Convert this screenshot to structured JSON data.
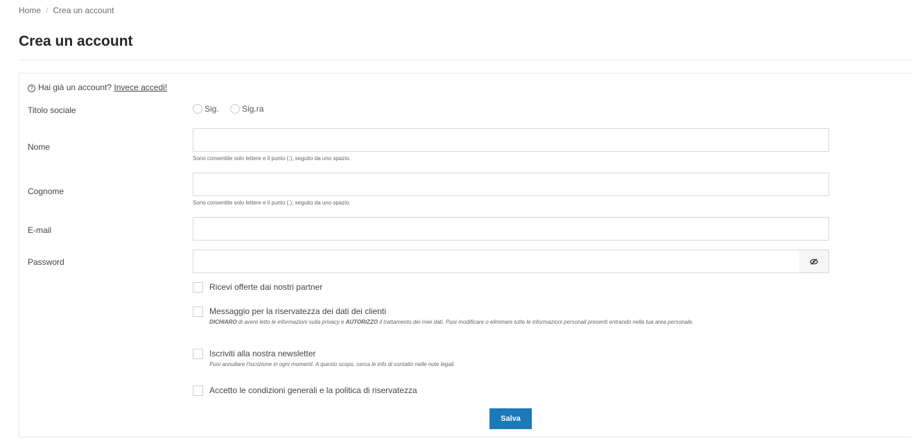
{
  "breadcrumb": {
    "home": "Home",
    "separator": "/",
    "current": "Crea un account"
  },
  "page_title": "Crea un account",
  "login_prompt": {
    "text": "Hai già un account?",
    "link": "Invece accedi!"
  },
  "form": {
    "social_title": {
      "label": "Titolo sociale",
      "options": [
        "Sig.",
        "Sig.ra"
      ]
    },
    "first_name": {
      "label": "Nome",
      "value": "",
      "hint": "Sono consentite solo lettere e il punto (.), seguito da uno spazio."
    },
    "last_name": {
      "label": "Cognome",
      "value": "",
      "hint": "Sono consentite solo lettere e il punto (.), seguito da uno spazio."
    },
    "email": {
      "label": "E-mail",
      "value": ""
    },
    "password": {
      "label": "Password",
      "value": "",
      "toggle_icon": "eye-slash-icon"
    },
    "optin": {
      "label": "Ricevi offerte dai nostri partner"
    },
    "privacy": {
      "label": "Messaggio per la riservatezza dei dati dei clienti",
      "desc_b1": "DICHIARO",
      "desc_t1": " di avere letto le informazioni sulla privacy e ",
      "desc_b2": "AUTORIZZO",
      "desc_t2": " il trattamento dei miei dati. Puoi modificare o eliminare tutte le informazioni personali presenti entrando nella tua area personale."
    },
    "newsletter": {
      "label": "Iscriviti alla nostra newsletter",
      "desc": "Puoi annullare l'iscrizione in ogni momenti. A questo scopo, cerca le info di contatto nelle note legali."
    },
    "terms": {
      "label": "Accetto le condizioni generali e la politica di riservatezza"
    },
    "submit": "Salva"
  },
  "colors": {
    "primary_button": "#1b79b8"
  }
}
